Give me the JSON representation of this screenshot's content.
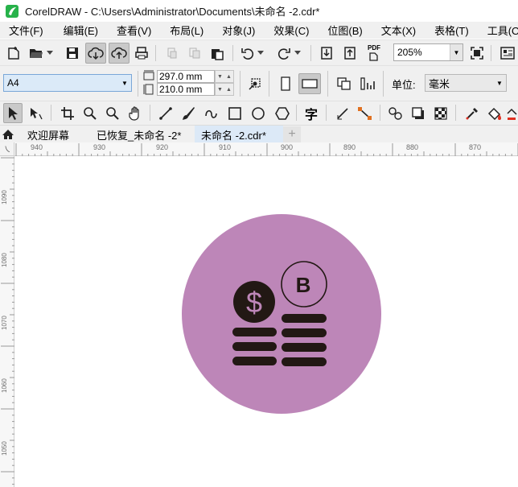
{
  "window": {
    "title": "CorelDRAW - C:\\Users\\Administrator\\Documents\\未命名 -2.cdr*"
  },
  "menu": [
    {
      "label": "文件(F)"
    },
    {
      "label": "编辑(E)"
    },
    {
      "label": "查看(V)"
    },
    {
      "label": "布局(L)"
    },
    {
      "label": "对象(J)"
    },
    {
      "label": "效果(C)"
    },
    {
      "label": "位图(B)"
    },
    {
      "label": "文本(X)"
    },
    {
      "label": "表格(T)"
    },
    {
      "label": "工具(O)"
    }
  ],
  "toolbar": {
    "zoom": "205%",
    "pdf_label": "PDF"
  },
  "property_bar": {
    "page_size": "A4",
    "width": "297.0 mm",
    "height": "210.0 mm",
    "unit_label": "单位:",
    "unit_value": "毫米"
  },
  "toolbox": {
    "text_tool_glyph": "字"
  },
  "tabs": [
    {
      "label": "欢迎屏幕",
      "active": false
    },
    {
      "label": "已恢复_未命名 -2*",
      "active": false
    },
    {
      "label": "未命名 -2.cdr*",
      "active": true
    }
  ],
  "ruler": {
    "corner_glyph": "㇏",
    "horizontal": [
      "940",
      "930",
      "920",
      "910",
      "900",
      "890",
      "880",
      "870"
    ],
    "vertical": [
      "1090",
      "1080",
      "1070",
      "1060",
      "1050"
    ]
  },
  "artwork": {
    "circle_color": "#bd86b8",
    "ink_color": "#221814",
    "dollar_symbol": "$",
    "bitcoin_letter": "B"
  }
}
